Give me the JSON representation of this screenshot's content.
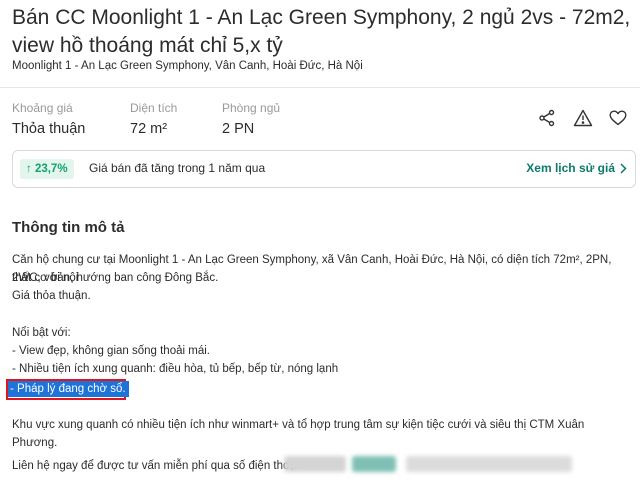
{
  "listing": {
    "title": "Bán CC Moonlight 1 - An Lạc Green Symphony, 2 ngủ 2vs - 72m2, view hồ thoáng mát chỉ 5,x tỷ",
    "address": "Moonlight 1 - An Lạc Green Symphony, Vân Canh, Hoài Đức, Hà Nội"
  },
  "stats": [
    {
      "label": "Khoảng giá",
      "value": "Thỏa thuận"
    },
    {
      "label": "Diện tích",
      "value": "72 m²"
    },
    {
      "label": "Phòng ngủ",
      "value": "2 PN"
    }
  ],
  "actions": {
    "icons": [
      "share-icon",
      "warning-icon",
      "heart-icon"
    ]
  },
  "price_trend": {
    "change": "↑ 23,7%",
    "text": "Giá bán đã tăng trong 1 năm qua",
    "link": "Xem lịch sử giá"
  },
  "description": {
    "heading": "Thông tin mô tả",
    "line1": "Căn hộ chung cư tại Moonlight 1 - An Lạc Green Symphony, xã Vân Canh, Hoài Đức, Hà Nội, có diện tích 72m², 2PN, 2WC, với nội",
    "line2": "thất cơ bản, hướng ban công Đông Bắc.",
    "line3": "Giá thỏa thuận.",
    "highlights_heading": "Nổi bật với:",
    "bullet1": "- View đẹp, không gian sống thoải mái.",
    "bullet2": "- Nhiều tiện ích xung quanh: điều hòa, tủ bếp, bếp từ, nóng lạnh",
    "bullet3": "- Pháp lý đang chờ sổ.",
    "area": "Khu vực xung quanh có nhiều tiện ích như winmart+ và tổ hợp trung tâm sự kiện tiệc cưới và siêu thị CTM Xuân Phương.",
    "contact": "Liên hệ ngay để được tư vấn miễn phí qua số điện thoại"
  },
  "colors": {
    "accent": "#0d7a6b",
    "badge_bg": "#e2f6ee",
    "badge_text": "#14a073",
    "highlight": "#1e73d8",
    "annotation": "#e0141d"
  }
}
